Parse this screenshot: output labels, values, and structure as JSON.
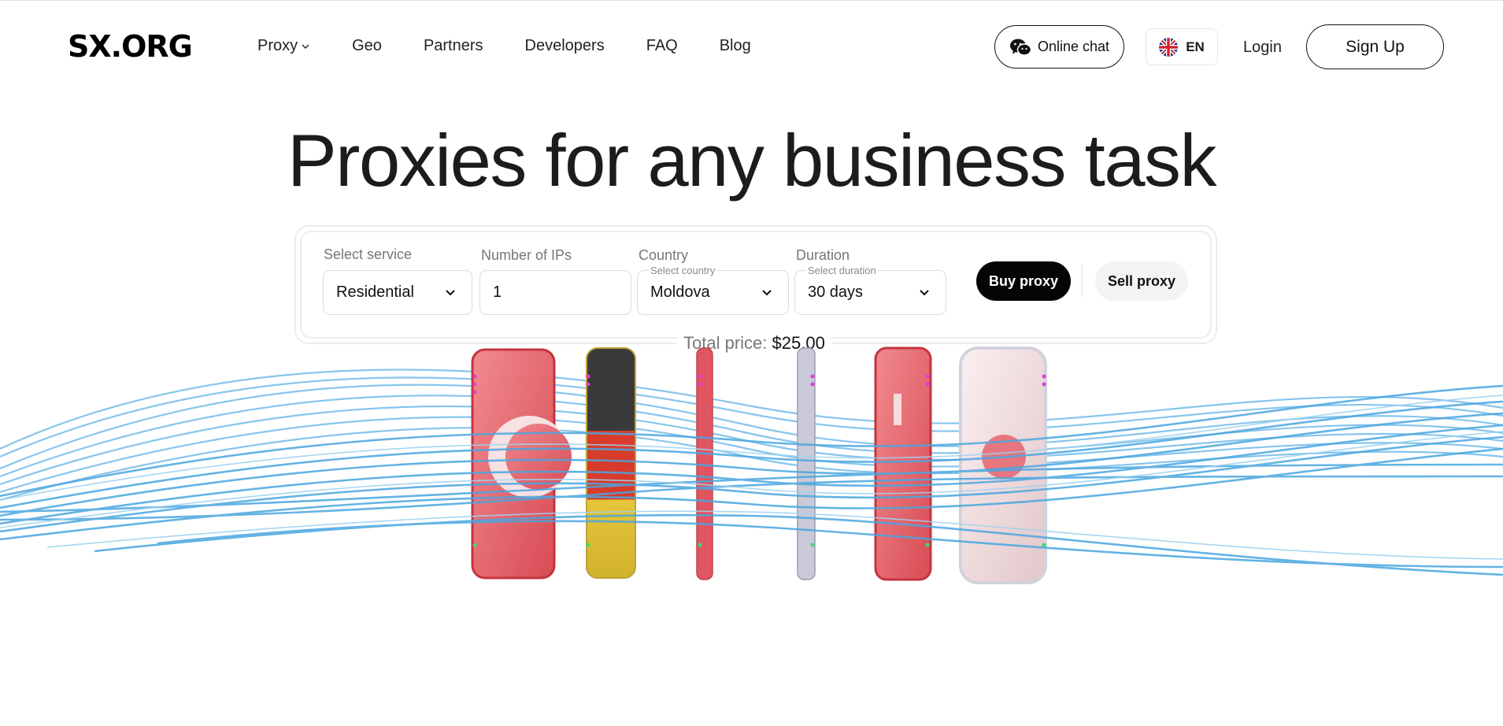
{
  "header": {
    "logo": "SX.ORG",
    "nav": [
      {
        "label": "Proxy",
        "has_dropdown": true
      },
      {
        "label": "Geo"
      },
      {
        "label": "Partners"
      },
      {
        "label": "Developers"
      },
      {
        "label": "FAQ"
      },
      {
        "label": "Blog"
      }
    ],
    "online_chat": "Online chat",
    "language": "EN",
    "login": "Login",
    "signup": "Sign Up"
  },
  "hero": {
    "title": "Proxies for any business task"
  },
  "order_form": {
    "service": {
      "label": "Select service",
      "value": "Residential"
    },
    "ips": {
      "label": "Number of IPs",
      "value": "1"
    },
    "country": {
      "label": "Country",
      "sub_label": "Select country",
      "value": "Moldova"
    },
    "duration": {
      "label": "Duration",
      "sub_label": "Select duration",
      "value": "30 days"
    },
    "buy_button": "Buy proxy",
    "sell_button": "Sell proxy",
    "total_label": "Total price:",
    "total_value": "$25.00"
  },
  "colors": {
    "primary": "#050505",
    "fiber_blue": "#4aa6e0",
    "accent_blue": "#1e7bd8"
  },
  "icons": {
    "chat": "wechat-icon",
    "flag": "uk-flag-icon",
    "chevron": "chevron-down-icon"
  }
}
